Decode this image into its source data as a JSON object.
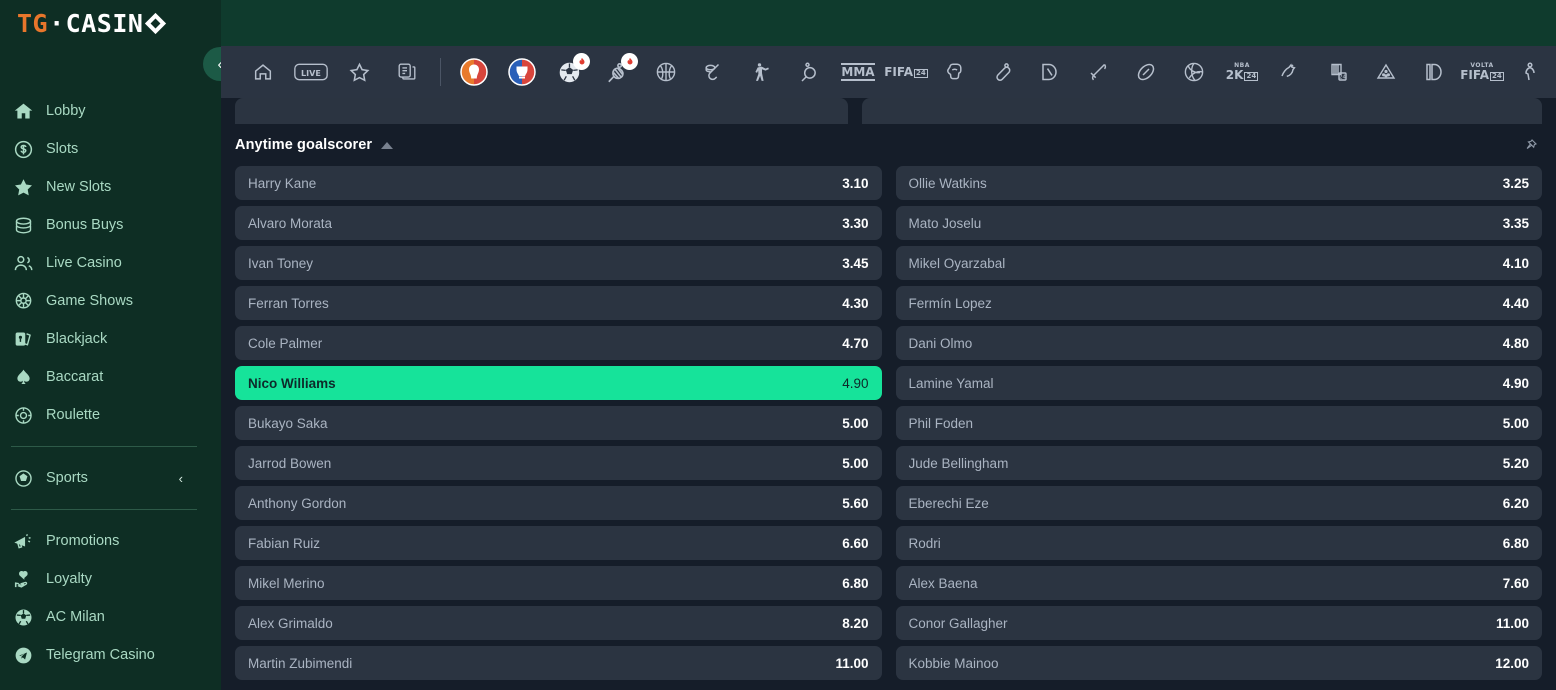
{
  "brand": {
    "logo_tg": "TG",
    "logo_dot": "·",
    "logo_casino": "CASIN",
    "collapse_icon": "‹"
  },
  "sidebar": {
    "items": [
      {
        "label": "Lobby",
        "icon": "home-icon"
      },
      {
        "label": "Slots",
        "icon": "dollar-coin-icon"
      },
      {
        "label": "New Slots",
        "icon": "star-icon"
      },
      {
        "label": "Bonus Buys",
        "icon": "coins-stack-icon"
      },
      {
        "label": "Live Casino",
        "icon": "people-icon"
      },
      {
        "label": "Game Shows",
        "icon": "wheel-icon"
      },
      {
        "label": "Blackjack",
        "icon": "cards-icon"
      },
      {
        "label": "Baccarat",
        "icon": "spade-icon"
      },
      {
        "label": "Roulette",
        "icon": "roulette-chip-icon"
      }
    ],
    "sports": {
      "label": "Sports",
      "icon": "soccer-ball-icon",
      "chevron": "‹"
    },
    "bottom_items": [
      {
        "label": "Promotions",
        "icon": "megaphone-icon"
      },
      {
        "label": "Loyalty",
        "icon": "heart-hand-icon"
      },
      {
        "label": "AC Milan",
        "icon": "football-icon"
      },
      {
        "label": "Telegram Casino",
        "icon": "telegram-icon"
      }
    ]
  },
  "sportsbar": {
    "items": [
      {
        "name": "home-icon",
        "kind": "home"
      },
      {
        "name": "live-icon",
        "kind": "live",
        "text": "LIVE"
      },
      {
        "name": "favourites-star-icon",
        "kind": "star"
      },
      {
        "name": "bet-slip-icon",
        "kind": "docs"
      },
      {
        "name": "divider",
        "kind": "divider"
      },
      {
        "name": "euro-2024-icon",
        "kind": "avatar-red"
      },
      {
        "name": "copa-america-icon",
        "kind": "avatar-blue"
      },
      {
        "name": "football-icon",
        "kind": "soccer",
        "badge": "flame-icon"
      },
      {
        "name": "lacrosse-icon",
        "kind": "lacrosse",
        "badge": "flame-icon"
      },
      {
        "name": "basketball-icon",
        "kind": "basketball"
      },
      {
        "name": "ice-hockey-icon",
        "kind": "hockey"
      },
      {
        "name": "counter-strike-icon",
        "kind": "cs"
      },
      {
        "name": "table-tennis-icon",
        "kind": "tabletennis"
      },
      {
        "name": "mma-icon",
        "kind": "text",
        "text": "MMA"
      },
      {
        "name": "fifa-24-icon",
        "kind": "fifa",
        "text": "FIFA",
        "sub": "24"
      },
      {
        "name": "boxing-icon",
        "kind": "boxing"
      },
      {
        "name": "cricket-icon",
        "kind": "cricket"
      },
      {
        "name": "nba-icon",
        "kind": "nbalogo"
      },
      {
        "name": "baseball-icon",
        "kind": "baseball"
      },
      {
        "name": "rugby-icon",
        "kind": "rugby"
      },
      {
        "name": "volleyball-icon",
        "kind": "volleyball"
      },
      {
        "name": "nba2k24-icon",
        "kind": "nba2k",
        "text": "NBA",
        "text2": "2K",
        "sub": "24"
      },
      {
        "name": "horse-racing-icon",
        "kind": "horse"
      },
      {
        "name": "fifa-volta-pack-icon",
        "kind": "fut24",
        "sub": "24"
      },
      {
        "name": "darts-icon",
        "kind": "darts"
      },
      {
        "name": "league-of-legends-icon",
        "kind": "lol"
      },
      {
        "name": "volta-fifa-icon",
        "kind": "volta",
        "text": "VOLTA",
        "text2": "FIFA",
        "sub": "24"
      },
      {
        "name": "more-sports-icon",
        "kind": "person"
      }
    ]
  },
  "market": {
    "title": "Anytime goalscorer",
    "sort_icon": "sort-ascending-icon",
    "pin_icon": "pin-icon",
    "selections": [
      {
        "name": "Harry Kane",
        "price": "3.10",
        "selected": false
      },
      {
        "name": "Ollie Watkins",
        "price": "3.25",
        "selected": false
      },
      {
        "name": "Alvaro Morata",
        "price": "3.30",
        "selected": false
      },
      {
        "name": "Mato Joselu",
        "price": "3.35",
        "selected": false
      },
      {
        "name": "Ivan Toney",
        "price": "3.45",
        "selected": false
      },
      {
        "name": "Mikel Oyarzabal",
        "price": "4.10",
        "selected": false
      },
      {
        "name": "Ferran Torres",
        "price": "4.30",
        "selected": false
      },
      {
        "name": "Fermín Lopez",
        "price": "4.40",
        "selected": false
      },
      {
        "name": "Cole Palmer",
        "price": "4.70",
        "selected": false
      },
      {
        "name": "Dani Olmo",
        "price": "4.80",
        "selected": false
      },
      {
        "name": "Nico Williams",
        "price": "4.90",
        "selected": true
      },
      {
        "name": "Lamine Yamal",
        "price": "4.90",
        "selected": false
      },
      {
        "name": "Bukayo Saka",
        "price": "5.00",
        "selected": false
      },
      {
        "name": "Phil Foden",
        "price": "5.00",
        "selected": false
      },
      {
        "name": "Jarrod Bowen",
        "price": "5.00",
        "selected": false
      },
      {
        "name": "Jude Bellingham",
        "price": "5.20",
        "selected": false
      },
      {
        "name": "Anthony Gordon",
        "price": "5.60",
        "selected": false
      },
      {
        "name": "Eberechi Eze",
        "price": "6.20",
        "selected": false
      },
      {
        "name": "Fabian Ruiz",
        "price": "6.60",
        "selected": false
      },
      {
        "name": "Rodri",
        "price": "6.80",
        "selected": false
      },
      {
        "name": "Mikel Merino",
        "price": "6.80",
        "selected": false
      },
      {
        "name": "Alex Baena",
        "price": "7.60",
        "selected": false
      },
      {
        "name": "Alex Grimaldo",
        "price": "8.20",
        "selected": false
      },
      {
        "name": "Conor Gallagher",
        "price": "11.00",
        "selected": false
      },
      {
        "name": "Martin Zubimendi",
        "price": "11.00",
        "selected": false
      },
      {
        "name": "Kobbie Mainoo",
        "price": "12.00",
        "selected": false
      }
    ]
  },
  "colors": {
    "brand_orange": "#e8762b",
    "sidebar_bg": "#0e2e24",
    "page_bg": "#151d29",
    "row_bg": "#2b3441",
    "selected_green": "#16e39a",
    "sports_bar_bg": "#2b3442"
  }
}
